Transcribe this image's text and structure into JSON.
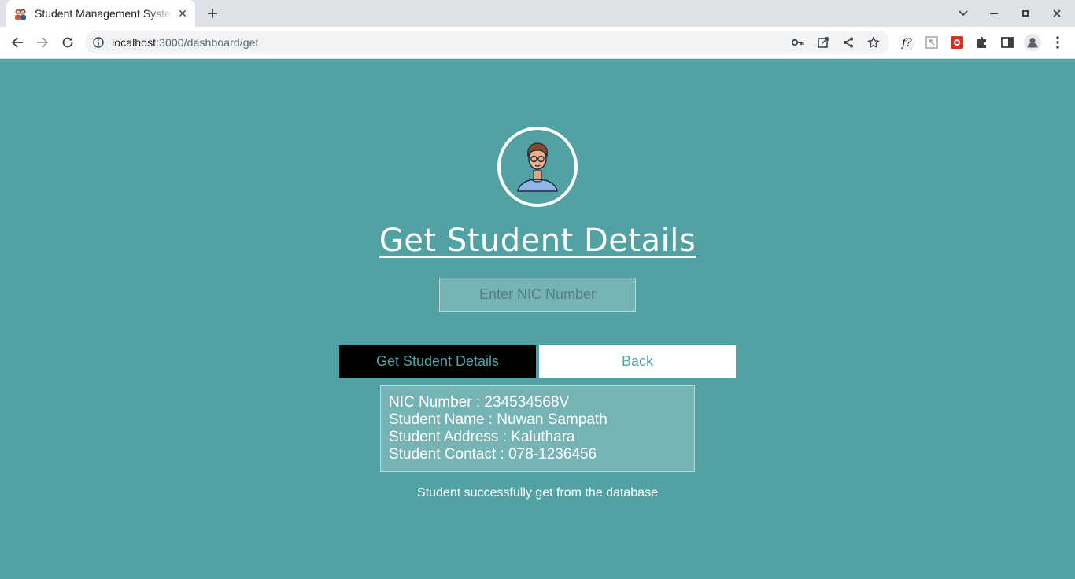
{
  "browser": {
    "tab": {
      "title": "Student Management System"
    },
    "address": {
      "host": "localhost",
      "path": ":3000/dashboard/get"
    }
  },
  "page": {
    "title": "Get Student Details",
    "nic_input": {
      "placeholder": "Enter NIC Number",
      "value": ""
    },
    "buttons": {
      "get_label": "Get Student Details",
      "back_label": "Back"
    },
    "result": {
      "nic": "NIC Number : 234534568V",
      "name": "Student Name : Nuwan Sampath",
      "address": "Student Address : Kaluthara",
      "contact": "Student Contact : 078-1236456"
    },
    "status_message": "Student successfully get from the database"
  },
  "colors": {
    "page_bg": "#52a2a4",
    "panel_bg": "#75b3b4",
    "accent": "#52a2a4"
  }
}
